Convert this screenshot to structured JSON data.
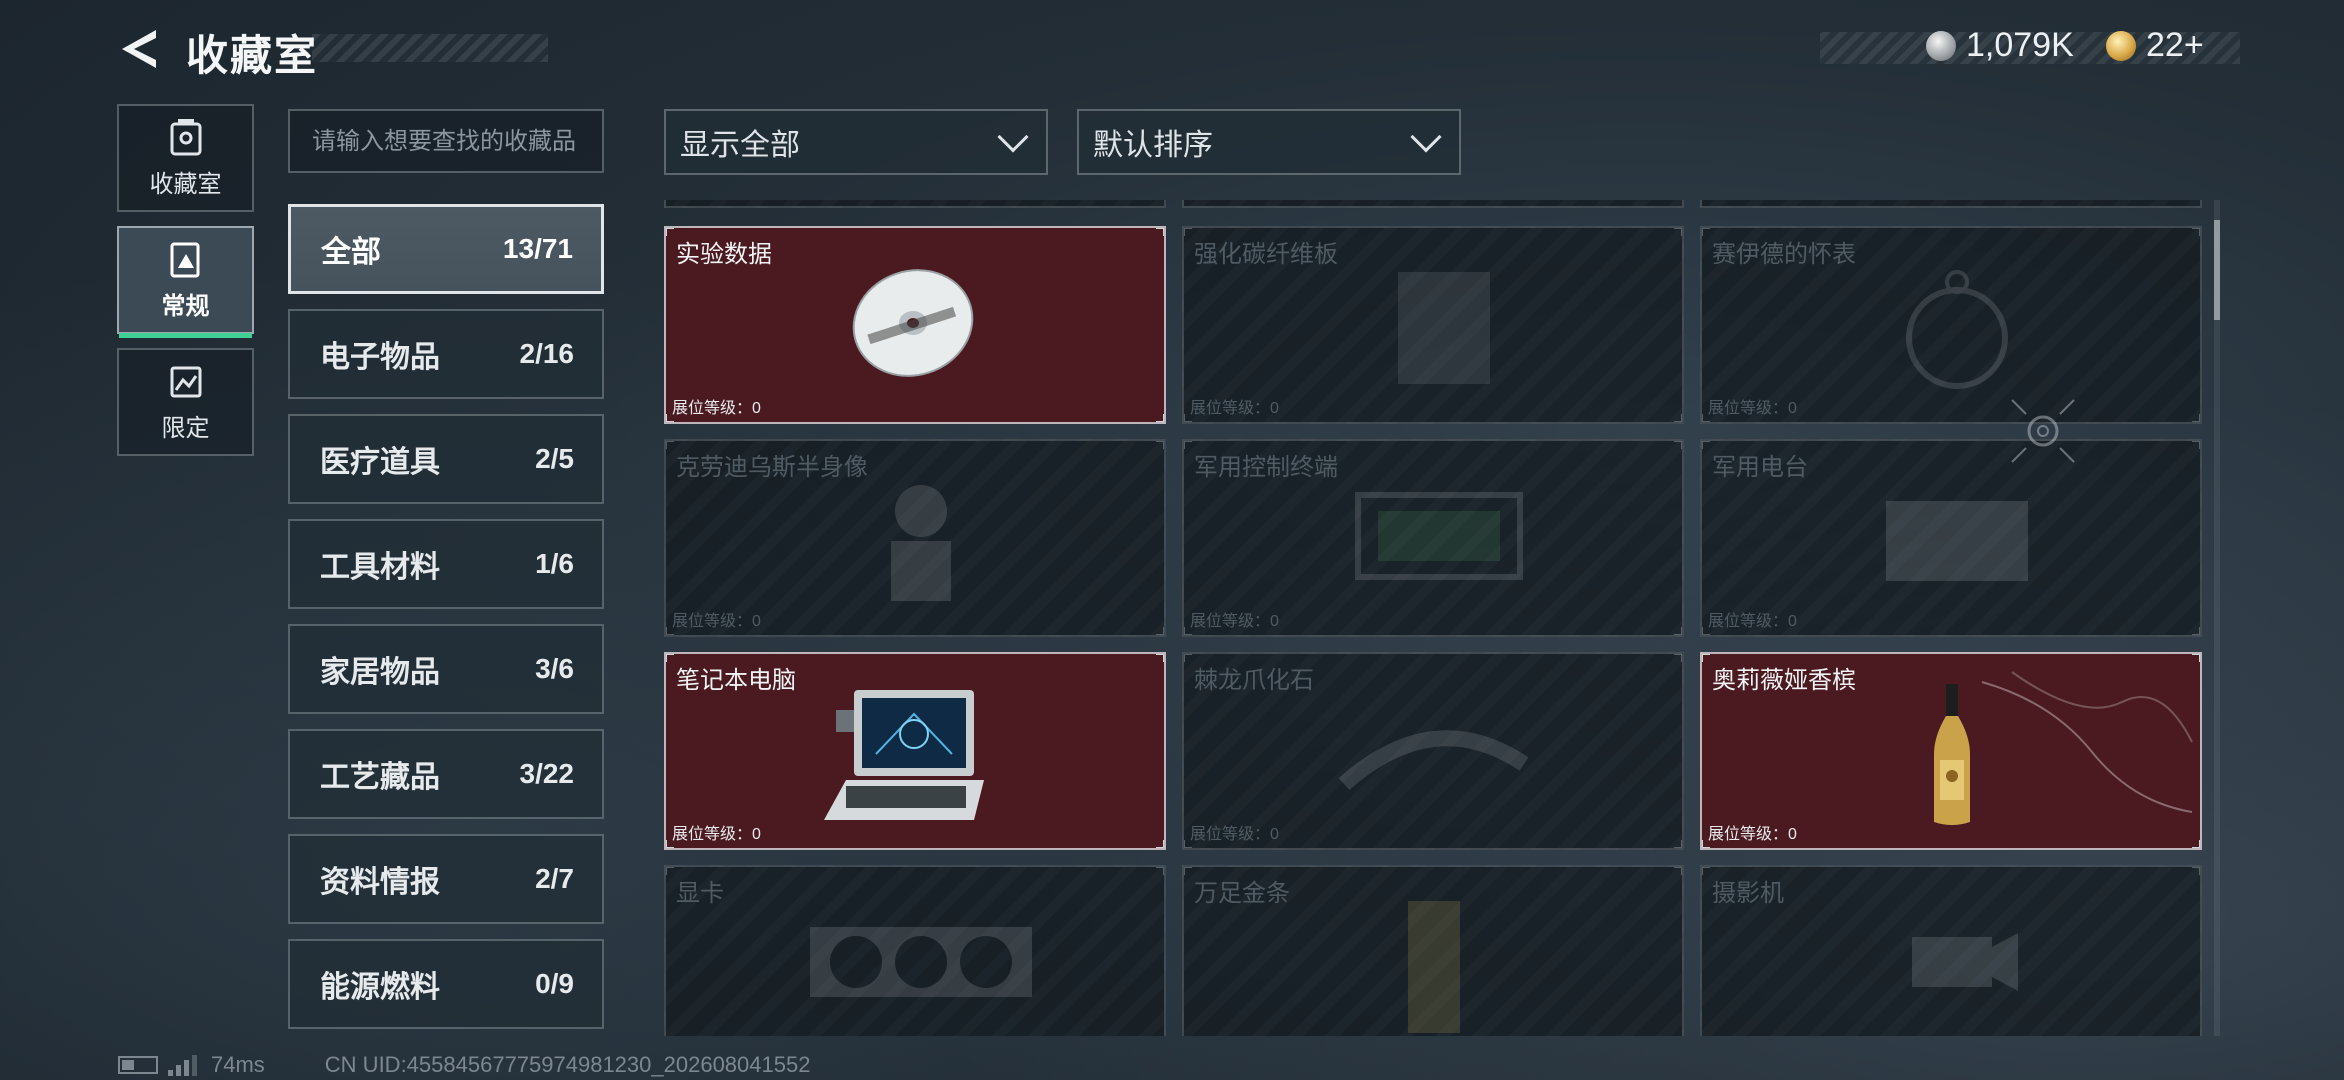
{
  "header": {
    "title": "收藏室",
    "currency": [
      {
        "icon": "silver-coin-icon",
        "value": "1,079K"
      },
      {
        "icon": "gold-token-icon",
        "value": "22+"
      }
    ]
  },
  "rail": [
    {
      "icon": "collection-room-icon",
      "label": "收藏室",
      "active": false
    },
    {
      "icon": "regular-icon",
      "label": "常规",
      "active": true
    },
    {
      "icon": "limited-icon",
      "label": "限定",
      "active": false
    }
  ],
  "search": {
    "placeholder": "请输入想要查找的收藏品"
  },
  "categories": [
    {
      "name": "全部",
      "count": "13/71",
      "active": true
    },
    {
      "name": "电子物品",
      "count": "2/16"
    },
    {
      "name": "医疗道具",
      "count": "2/5"
    },
    {
      "name": "工具材料",
      "count": "1/6"
    },
    {
      "name": "家居物品",
      "count": "3/6"
    },
    {
      "name": "工艺藏品",
      "count": "3/22"
    },
    {
      "name": "资料情报",
      "count": "2/7"
    },
    {
      "name": "能源燃料",
      "count": "0/9"
    }
  ],
  "filters": {
    "display": "显示全部",
    "sort": "默认排序"
  },
  "level_label": "展位等级：0",
  "items": [
    {
      "name": "实验数据",
      "owned": true,
      "icon": "disc-icon"
    },
    {
      "name": "强化碳纤维板",
      "owned": false,
      "icon": "carbon-plate-icon"
    },
    {
      "name": "赛伊德的怀表",
      "owned": false,
      "icon": "pocket-watch-icon"
    },
    {
      "name": "克劳迪乌斯半身像",
      "owned": false,
      "icon": "bust-icon"
    },
    {
      "name": "军用控制终端",
      "owned": false,
      "icon": "terminal-icon"
    },
    {
      "name": "军用电台",
      "owned": false,
      "icon": "radio-icon"
    },
    {
      "name": "笔记本电脑",
      "owned": true,
      "icon": "laptop-icon"
    },
    {
      "name": "棘龙爪化石",
      "owned": false,
      "icon": "fossil-claw-icon"
    },
    {
      "name": "奥莉薇娅香槟",
      "owned": true,
      "icon": "champagne-icon"
    },
    {
      "name": "显卡",
      "owned": false,
      "icon": "graphics-card-icon"
    },
    {
      "name": "万足金条",
      "owned": false,
      "icon": "gold-bar-icon"
    },
    {
      "name": "摄影机",
      "owned": false,
      "icon": "camera-icon"
    }
  ],
  "footer": {
    "ping": "74ms",
    "uid": "CN UID:45584567775974981230_202608041552"
  }
}
